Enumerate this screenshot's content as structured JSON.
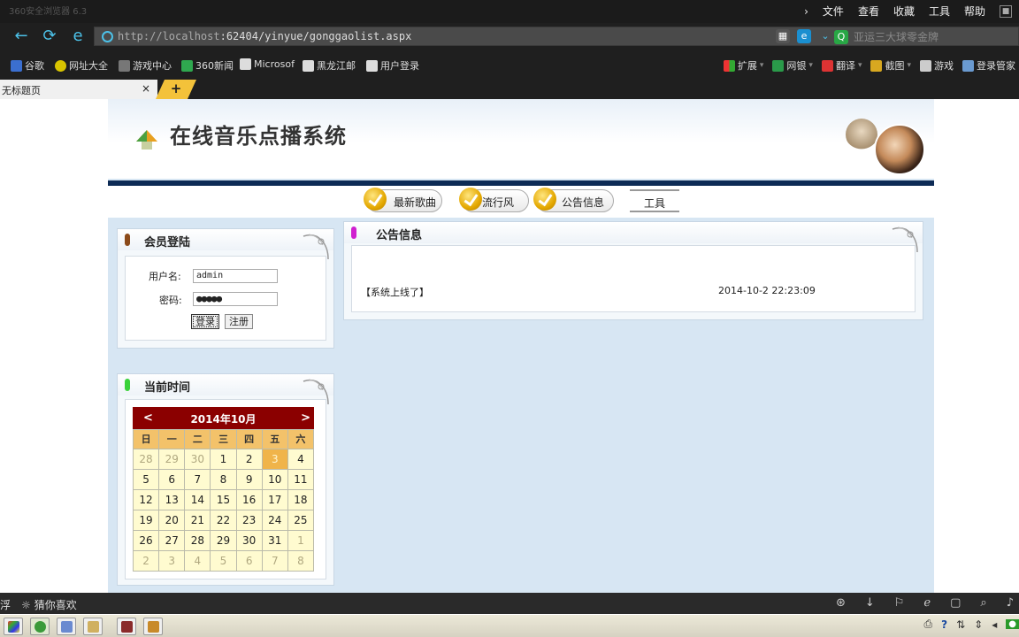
{
  "browser": {
    "app_title": "360安全浏览器 6.3",
    "menu": [
      "文件",
      "查看",
      "收藏",
      "工具",
      "帮助"
    ],
    "url_host": "http://localhost",
    "url_path": ":62404/yinyue/gonggaolist.aspx",
    "news_ticker": "亚运三大球零金牌",
    "bookmarks": [
      "谷歌",
      "网址大全",
      "游戏中心",
      "360新闻",
      "Microsof",
      "黑龙江邮",
      "用户登录"
    ],
    "tools": [
      "扩展",
      "网银",
      "翻译",
      "截图",
      "游戏",
      "登录管家"
    ],
    "tab_title": "无标题页",
    "tab_close": "×",
    "new_tab": "+"
  },
  "site": {
    "title": "在线音乐点播系统",
    "nav": [
      "最新歌曲",
      "流行风",
      "公告信息",
      "工具"
    ]
  },
  "login": {
    "title": "会员登陆",
    "username_label": "用户名:",
    "username_value": "admin",
    "password_label": "密码:",
    "password_value": "●●●●●",
    "login_button": "登录",
    "register_button": "注册"
  },
  "time_panel": {
    "title": "当前时间"
  },
  "calendar": {
    "prev": "<",
    "next": ">",
    "month_label": "2014年10月",
    "weekdays": [
      "日",
      "一",
      "二",
      "三",
      "四",
      "五",
      "六"
    ],
    "weeks": [
      [
        "28",
        "29",
        "30",
        "1",
        "2",
        "3",
        "4"
      ],
      [
        "5",
        "6",
        "7",
        "8",
        "9",
        "10",
        "11"
      ],
      [
        "12",
        "13",
        "14",
        "15",
        "16",
        "17",
        "18"
      ],
      [
        "19",
        "20",
        "21",
        "22",
        "23",
        "24",
        "25"
      ],
      [
        "26",
        "27",
        "28",
        "29",
        "30",
        "31",
        "1"
      ],
      [
        "2",
        "3",
        "4",
        "5",
        "6",
        "7",
        "8"
      ]
    ],
    "other_month_cells": [
      [
        0,
        0
      ],
      [
        0,
        1
      ],
      [
        0,
        2
      ],
      [
        4,
        6
      ],
      [
        5,
        0
      ],
      [
        5,
        1
      ],
      [
        5,
        2
      ],
      [
        5,
        3
      ],
      [
        5,
        4
      ],
      [
        5,
        5
      ],
      [
        5,
        6
      ]
    ],
    "selected_cell": [
      0,
      5
    ],
    "colors": {
      "header": "#8b0000",
      "weekday_row": "#f3c26a",
      "cell": "#fffbd0",
      "today": "#f0b44a"
    }
  },
  "notices": {
    "title": "公告信息",
    "items": [
      {
        "text": "【系统上线了】",
        "date": "2014-10-2 22:23:09"
      }
    ]
  },
  "status": {
    "left_char": "浮",
    "guess_label": "猜你喜欢"
  }
}
